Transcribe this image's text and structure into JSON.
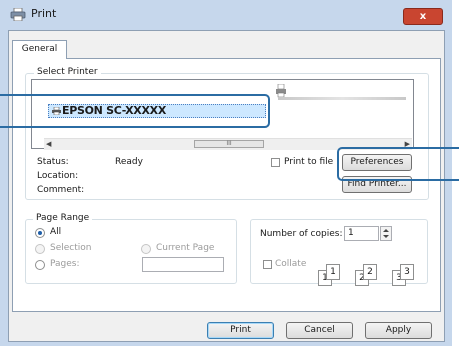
{
  "window": {
    "title": "Print",
    "close_glyph": "x"
  },
  "tabs": [
    {
      "label": "General"
    }
  ],
  "select_printer": {
    "group_title": "Select Printer",
    "selected_printer": "EPSON SC-XXXXX",
    "scroll_thumb_glyph": "III",
    "status_label": "Status:",
    "status_value": "Ready",
    "location_label": "Location:",
    "comment_label": "Comment:",
    "print_to_file_label": "Print to file",
    "preferences_label": "Preferences",
    "find_printer_label": "Find Printer..."
  },
  "page_range": {
    "group_title": "Page Range",
    "all_label": "All",
    "selection_label": "Selection",
    "current_page_label": "Current Page",
    "pages_label": "Pages:",
    "pages_value": ""
  },
  "copies": {
    "number_label": "Number of copies:",
    "number_value": "1",
    "collate_label": "Collate",
    "collate_pages": [
      "1",
      "1",
      "2",
      "2",
      "3",
      "3"
    ]
  },
  "footer": {
    "print_label": "Print",
    "cancel_label": "Cancel",
    "apply_label": "Apply"
  },
  "icons": {
    "printer": "printer-icon",
    "close": "close-icon",
    "spinner": "spinner-arrows-icon"
  },
  "colors": {
    "title_bar": "#c6d7ec",
    "close_button": "#c94530",
    "selection_highlight": "#cde8ff",
    "callout_border": "#2b6ca3"
  }
}
